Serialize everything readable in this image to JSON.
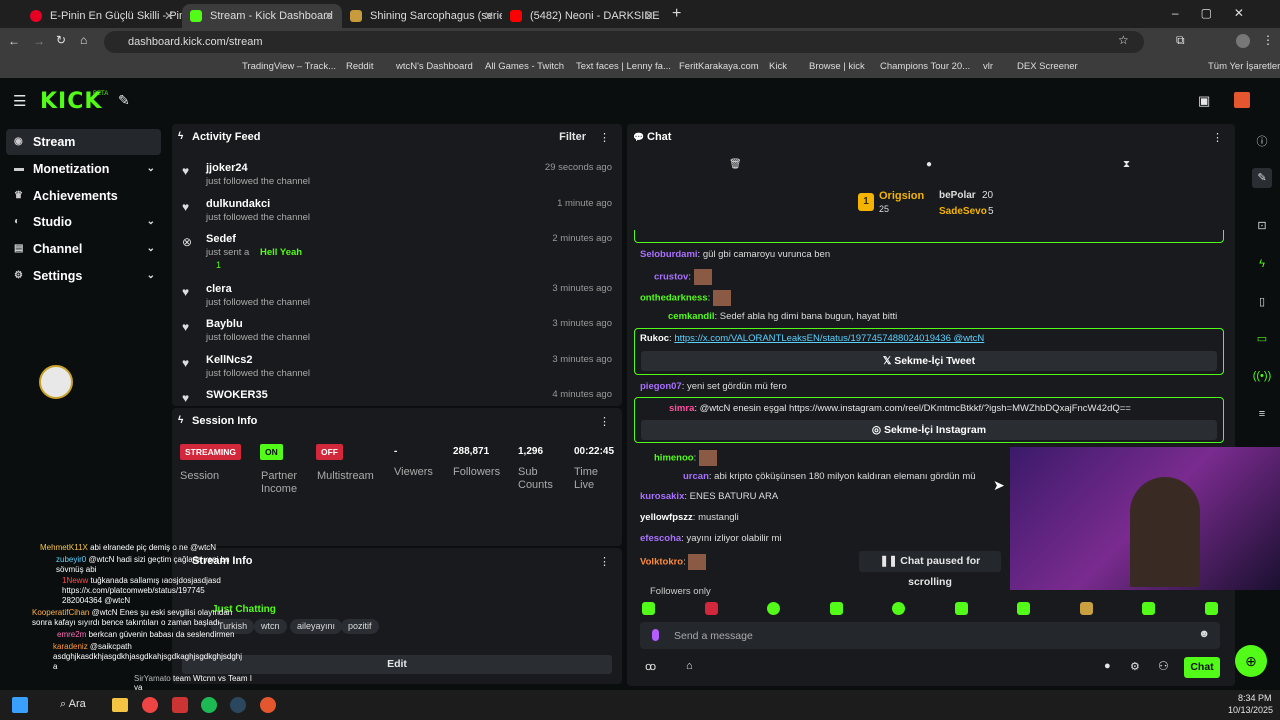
{
  "browser": {
    "tabs": [
      {
        "title": "E-Pinin En Güçlü Skilli - Pindirin"
      },
      {
        "title": "Stream - Kick Dashboard"
      },
      {
        "title": "Shining Sarcophagus (series) | V"
      },
      {
        "title": "(5482) Neoni - DARKSIDE (Offic"
      }
    ],
    "url": "dashboard.kick.com/stream",
    "bookmarks": [
      "TradingView – Track...",
      "Reddit",
      "wtcN's Dashboard",
      "All Games - Twitch",
      "Text faces | Lenny fa...",
      "FeritKarakaya.com",
      "Kick",
      "Browse | kick",
      "Champions Tour 20...",
      "vlr",
      "DEX Screener",
      "Tüm Yer İşaretleri"
    ]
  },
  "brand": {
    "logo": "KICK",
    "beta": "BETA"
  },
  "sidebar": {
    "items": [
      {
        "label": "Stream",
        "icon": "broadcast-icon"
      },
      {
        "label": "Monetization",
        "icon": "money-icon"
      },
      {
        "label": "Achievements",
        "icon": "trophy-icon"
      },
      {
        "label": "Studio",
        "icon": "studio-icon"
      },
      {
        "label": "Channel",
        "icon": "channel-icon"
      },
      {
        "label": "Settings",
        "icon": "gear-icon"
      }
    ]
  },
  "activity": {
    "title": "Activity Feed",
    "filter": "Filter",
    "items": [
      {
        "user": "jjoker24",
        "action": "just followed the channel",
        "time": "29 seconds ago"
      },
      {
        "user": "dulkundakci",
        "action": "just followed the channel",
        "time": "1 minute ago"
      },
      {
        "user": "Sedef",
        "action": "just sent a",
        "extra": "Hell Yeah",
        "count": "1",
        "time": "2 minutes ago"
      },
      {
        "user": "clera",
        "action": "just followed the channel",
        "time": "3 minutes ago"
      },
      {
        "user": "Bayblu",
        "action": "just followed the channel",
        "time": "3 minutes ago"
      },
      {
        "user": "KellNcs2",
        "action": "just followed the channel",
        "time": "3 minutes ago"
      },
      {
        "user": "SWOKER35",
        "action": "",
        "time": "4 minutes ago"
      }
    ]
  },
  "session": {
    "title": "Session Info",
    "cols": [
      {
        "badge": "STREAMING",
        "label": "Session"
      },
      {
        "badge": "ON",
        "label": "Partner Income"
      },
      {
        "badge": "OFF",
        "label": "Multistream"
      },
      {
        "value": "-",
        "label": "Viewers"
      },
      {
        "value": "288,871",
        "label": "Followers"
      },
      {
        "value": "1,296",
        "label": "Sub Counts"
      },
      {
        "value": "00:22:45",
        "label": "Time Live"
      }
    ]
  },
  "stream_info": {
    "title": "Stream Info",
    "category": "Just Chatting",
    "tags": [
      "Turkish",
      "wtcn",
      "aileyayını",
      "pozitif"
    ],
    "edit": "Edit"
  },
  "chat": {
    "title": "Chat",
    "leaders": [
      {
        "rank": "1",
        "name": "Origsion",
        "score": "25"
      },
      {
        "name": "bePolar",
        "score": "20"
      },
      {
        "name": "SadeSevo",
        "score": "5"
      }
    ],
    "messages": [
      {
        "user": "Seloburdami",
        "text": "gül gbi camaroyu vurunca ben",
        "color": "#a970ff"
      },
      {
        "user": "crustov",
        "text": "",
        "color": "#a970ff"
      },
      {
        "user": "onthedarkness",
        "text": "",
        "color": "#53fc18"
      },
      {
        "user": "cemkandil",
        "text": "Sedef abla hg dimi bana bugun, hayat bitti",
        "color": "#53fc18"
      },
      {
        "user": "Rukoc",
        "text": "https://x.com/VALORANTLeaksEN/status/1977457488024019436 @wtcN",
        "color": "#ffffff"
      },
      {
        "user": "piegon07",
        "text": "yeni set gördün mü fero",
        "color": "#a970ff"
      },
      {
        "user": "simra",
        "text": "@wtcN enesin eşgal https://www.instagram.com/reel/DKmtmcBtkkf/?igsh=MWZhbDQxajFncW42dQ==",
        "color": "#ff4fa0"
      },
      {
        "user": "himenoo",
        "text": "",
        "color": "#53fc18"
      },
      {
        "user": "urcan",
        "text": "abi kripto çöküşünsen 180 milyon kaldıran elemanı gördün mü",
        "color": "#a970ff"
      },
      {
        "user": "kurosakix",
        "text": "ENES BATURU ARA",
        "color": "#a970ff"
      },
      {
        "user": "yellowfpszz",
        "text": "mustangli",
        "color": "#ffffff"
      },
      {
        "user": "efescoha",
        "text": "yayını izliyor olabilir mi",
        "color": "#a970ff"
      },
      {
        "user": "Volktokro",
        "text": "",
        "color": "#ff8a3d"
      }
    ],
    "tweet_btn": "Sekme-İçi Tweet",
    "insta_btn": "Sekme-İçi Instagram",
    "paused": "Chat paused for scrolling",
    "followers_only": "Followers only",
    "placeholder": "Send a message",
    "send": "Chat"
  },
  "overlay": {
    "lines": [
      {
        "user": "MehmetK11X",
        "text": "abi elranede piç demiş o ne @wtcN"
      },
      {
        "user": "zubeyir0",
        "text": "@wtcN hadi sizi geçtim çağlarla yeni bn sövmüş abi"
      },
      {
        "user": "1Neww",
        "text": "tuğkanada sallamış ıaosjdosjasdjasd https://x.com/platcomweb/status/197745 282004364 @wtcN"
      },
      {
        "user": "KooperatifCihan",
        "text": "@wtcN Enes şu eski sevgilisi olayından sonra kafayı sıyırdı bence takıntıları o zaman başladı"
      },
      {
        "user": "emre2m",
        "text": "berkcan güvenin babası da seslendirmen"
      },
      {
        "user": "karadeniz",
        "text": "@saikcpath asdghjkasdkhjasgdkhjasgdkahjsgdkaghjsgdkghjsdghj a"
      },
      {
        "user": "SirYamato",
        "text": "team Wtcnn vs Team I ya"
      }
    ]
  },
  "taskbar": {
    "search": "Ara",
    "time": "8:34 PM",
    "date": "10/13/2025"
  }
}
